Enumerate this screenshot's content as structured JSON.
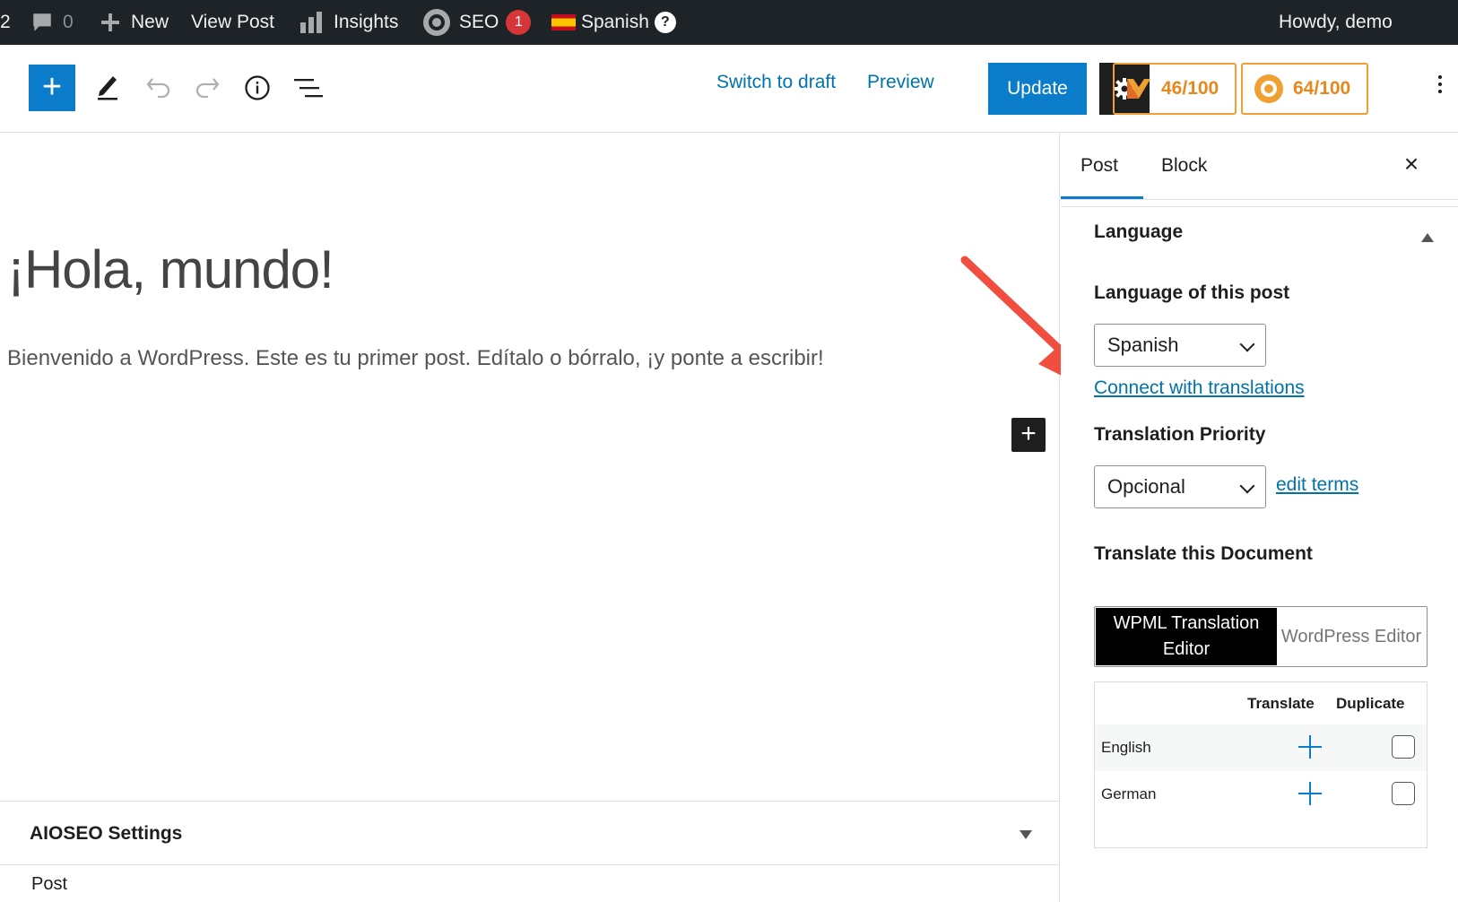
{
  "admin_bar": {
    "count_left": "2",
    "comments_count": "0",
    "new_label": "New",
    "view_post_label": "View Post",
    "insights_label": "Insights",
    "seo_label": "SEO",
    "seo_badge": "1",
    "language_label": "Spanish",
    "help_symbol": "?",
    "howdy_label": "Howdy, demo"
  },
  "toolbar": {
    "add_symbol": "+",
    "switch_draft_label": "Switch to draft",
    "preview_label": "Preview",
    "update_label": "Update",
    "score_1": "46/100",
    "score_2": "64/100"
  },
  "canvas": {
    "title": "¡Hola, mundo!",
    "body": "Bienvenido a WordPress. Este es tu primer post. Edítalo o bórralo, ¡y ponte a escribir!",
    "inserter_symbol": "+",
    "aioseo_title": "AIOSEO Settings",
    "footer_breadcrumb": "Post"
  },
  "sidebar": {
    "tabs": [
      {
        "label": "Post"
      },
      {
        "label": "Block"
      }
    ],
    "close_symbol": "×",
    "language_panel_title": "Language",
    "language_of_post_label": "Language of this post",
    "language_select_value": "Spanish",
    "connect_link": "Connect with translations",
    "priority_label": "Translation Priority",
    "priority_select_value": "Opcional",
    "edit_terms_link": "edit terms",
    "translate_doc_label": "Translate this Document",
    "editor_options": [
      "WPML Translation Editor",
      "WordPress Editor"
    ],
    "table": {
      "col_translate": "Translate",
      "col_duplicate": "Duplicate",
      "rows": [
        {
          "language": "English"
        },
        {
          "language": "German"
        }
      ]
    }
  },
  "colors": {
    "admin_bar_bg": "#1d2327",
    "primary": "#0a7cc9",
    "link": "#0073aa",
    "score_orange": "#e5891f",
    "annotation_arrow": "#f04e3e"
  },
  "icons": [
    "comment-icon",
    "plus-icon",
    "insights-icon",
    "seo-gear-icon",
    "spain-flag-icon",
    "help-icon",
    "pencil-icon",
    "undo-icon",
    "redo-icon",
    "info-icon",
    "list-view-icon",
    "settings-gear-icon",
    "aioseo-logo-icon",
    "seo-score-logo-icon",
    "kebab-menu-icon",
    "close-icon",
    "caret-up-icon",
    "caret-down-icon",
    "chevron-down-icon"
  ]
}
